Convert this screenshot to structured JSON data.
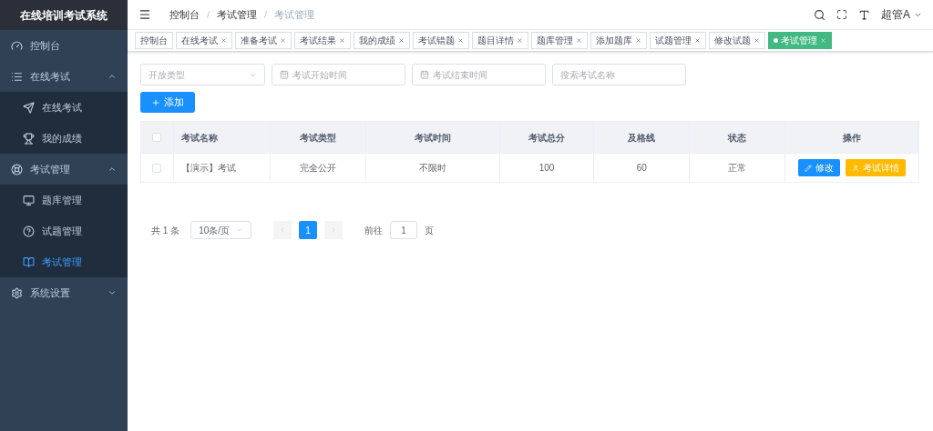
{
  "sidebar": {
    "title": "在线培训考试系统",
    "items": [
      {
        "label": "控制台",
        "selected": false
      },
      {
        "label": "在线考试",
        "expanded": true,
        "selected": false,
        "children": [
          {
            "label": "在线考试",
            "selected": false
          },
          {
            "label": "我的成绩",
            "selected": false
          }
        ]
      },
      {
        "label": "考试管理",
        "expanded": true,
        "selected": false,
        "children": [
          {
            "label": "题库管理",
            "selected": false
          },
          {
            "label": "试题管理",
            "selected": false
          },
          {
            "label": "考试管理",
            "selected": true
          }
        ]
      },
      {
        "label": "系统设置",
        "expanded": false,
        "selected": false
      }
    ]
  },
  "header": {
    "breadcrumb": [
      "控制台",
      "考试管理",
      "考试管理"
    ],
    "separator": "/",
    "user": "超管A"
  },
  "tags": [
    {
      "label": "控制台",
      "closable": false,
      "selected": false
    },
    {
      "label": "在线考试",
      "closable": true,
      "selected": false
    },
    {
      "label": "准备考试",
      "closable": true,
      "selected": false
    },
    {
      "label": "考试结果",
      "closable": true,
      "selected": false
    },
    {
      "label": "我的成绩",
      "closable": true,
      "selected": false
    },
    {
      "label": "考试错题",
      "closable": true,
      "selected": false
    },
    {
      "label": "题目详情",
      "closable": true,
      "selected": false
    },
    {
      "label": "题库管理",
      "closable": true,
      "selected": false
    },
    {
      "label": "添加题库",
      "closable": true,
      "selected": false
    },
    {
      "label": "试题管理",
      "closable": true,
      "selected": false
    },
    {
      "label": "修改试题",
      "closable": true,
      "selected": false
    },
    {
      "label": "考试管理",
      "closable": true,
      "selected": true
    }
  ],
  "filters": [
    {
      "kind": "select",
      "placeholder": "开放类型"
    },
    {
      "kind": "date",
      "placeholder": "考试开始时间"
    },
    {
      "kind": "date",
      "placeholder": "考试结束时间"
    },
    {
      "kind": "text",
      "placeholder": "搜索考试名称"
    }
  ],
  "add_button": "添加",
  "table": {
    "all_checked": false,
    "columns": [
      "考试名称",
      "考试类型",
      "考试时间",
      "考试总分",
      "及格线",
      "状态",
      "操作"
    ],
    "rows": [
      {
        "checked": false,
        "cells": [
          "【演示】考试",
          "完全公开",
          "不限时",
          "100",
          "60",
          "正常"
        ],
        "actions": [
          {
            "kind": "edit",
            "label": "修改"
          },
          {
            "kind": "detail",
            "label": "考试详情"
          }
        ]
      }
    ]
  },
  "pagination": {
    "total": "共 1 条",
    "page_size": "10条/页",
    "pages": [
      {
        "label": "1",
        "selected": true
      }
    ],
    "goto_label": "前往",
    "goto_value": "1",
    "goto_suffix": "页"
  }
}
